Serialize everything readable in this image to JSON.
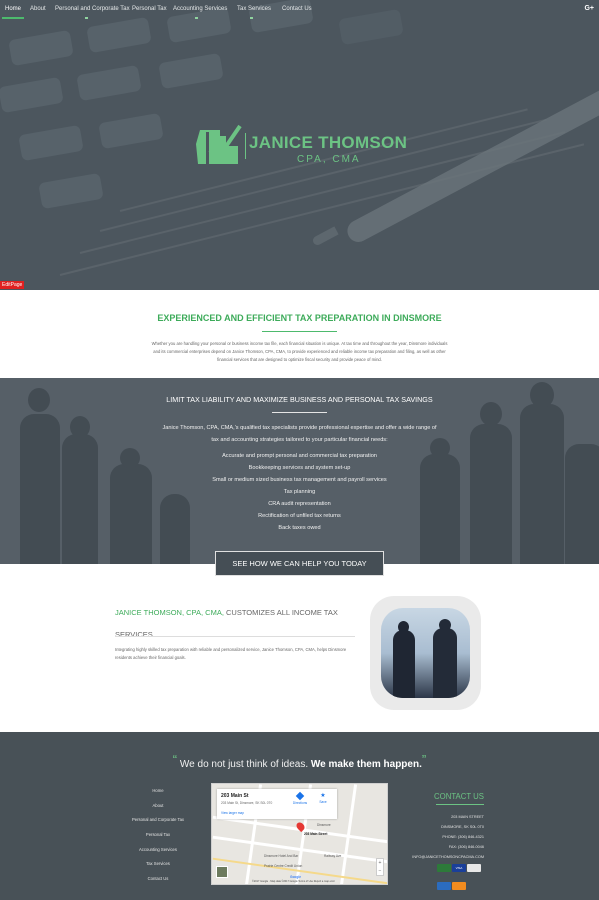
{
  "nav": {
    "items": [
      {
        "label": "Home",
        "active": true
      },
      {
        "label": "About"
      },
      {
        "label": "Personal and Corporate Tax"
      },
      {
        "label": "Personal Tax"
      },
      {
        "label": "Accounting Services"
      },
      {
        "label": "Tax Services"
      },
      {
        "label": "Contact Us"
      }
    ],
    "social_label": "G+"
  },
  "hero": {
    "logo_name": "JANICE THOMSON",
    "logo_sub": "CPA, CMA",
    "edit_label": "EditPage"
  },
  "intro": {
    "title": "EXPERIENCED AND EFFICIENT TAX PREPARATION IN DINSMORE",
    "body": "Whether you are handling your personal or business income tax file, each financial situation is unique. At tax time and throughout the year, Dinsmore individuals and its commercial enterprises depend on Janice Thomson, CPA, CMA, to provide experienced and reliable income tax preparation and filing, as well as other financial services that are designed to optimize fiscal security and provide peace of mind."
  },
  "savings": {
    "title": "LIMIT TAX LIABILITY AND MAXIMIZE BUSINESS AND PERSONAL TAX SAVINGS",
    "intro": "Janice Thomson, CPA, CMA,'s qualified tax specialists provide professional expertise and offer a wide range of tax and accounting strategies tailored to your particular financial needs:",
    "items": [
      "Accurate and prompt personal and commercial tax preparation",
      "Bookkeeping services and system set-up",
      "Small or medium sized business tax management and payroll services",
      "Tax planning",
      "CRA audit representation",
      "Rectification of unfiled tax returns",
      "Back taxes owed"
    ],
    "cta": "SEE HOW WE CAN HELP YOU TODAY"
  },
  "customize": {
    "title_highlight": "JANICE THOMSON, CPA, CMA,",
    "title_rest": " CUSTOMIZES ALL INCOME TAX SERVICES",
    "body": "Integrating highly skilled tax preparation with reliable and personalized service, Janice Thomson, CPA, CMA, helps Dinsmore residents achieve their financial goals."
  },
  "footer": {
    "quote_open": "“",
    "quote_plain": " We do not just think of ideas. ",
    "quote_bold": "We make them happen.",
    "quote_close": "”",
    "links": [
      "Home",
      "About",
      "Personal and Corporate Tax",
      "Personal Tax",
      "Accounting Services",
      "Tax Services",
      "Contact Us"
    ],
    "map": {
      "place": "203 Main St",
      "address": "203 Main St, Dinsmore, SK S0L 0T0",
      "larger_map": "View larger map",
      "directions": "Directions",
      "save": "Save",
      "label_pin": "203 Main Street",
      "label_town": "Dinsmore",
      "label_hotel": "Dinsmore Hotel And Bar",
      "label_coop": "Prairie Centre Credit Union",
      "label_street": "Railway Ave",
      "attribution": "©2017 Google · Map data ©2017 Google   Terms of Use   Report a map error",
      "google": "Google"
    },
    "contact": {
      "title": "CONTACT US",
      "lines": [
        "203 MAIN STREET",
        "DINSMORE, SK S0L 0T0",
        "PHONE: (306) 846-4321",
        "FAX: (306) 846-0046",
        "INFO@JANICETHOMSONCPACMA.COM"
      ]
    },
    "cards": [
      {
        "label": "",
        "color": "#2d7a3a"
      },
      {
        "label": "VISA",
        "color": "#1a3f9a"
      },
      {
        "label": "",
        "color": "#e8e8e8"
      },
      {
        "label": "",
        "color": "#2b6cbf"
      },
      {
        "label": "",
        "color": "#f28c1f"
      }
    ]
  },
  "colors": {
    "accent": "#4dba6d",
    "hero_bg": "#4c565e",
    "footer_bg": "#485157"
  }
}
